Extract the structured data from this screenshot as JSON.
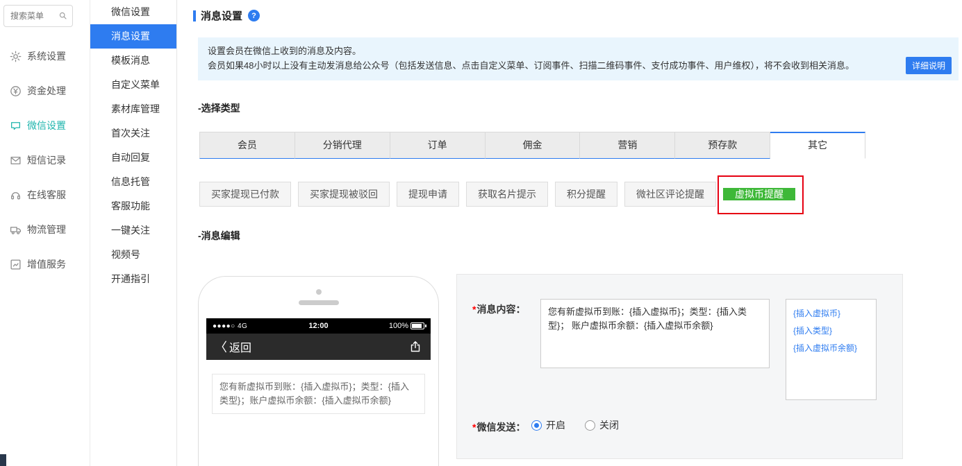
{
  "sidebar": {
    "search": {
      "placeholder": "搜索菜单"
    },
    "items": [
      {
        "label": "系统设置"
      },
      {
        "label": "资金处理"
      },
      {
        "label": "微信设置"
      },
      {
        "label": "短信记录"
      },
      {
        "label": "在线客服"
      },
      {
        "label": "物流管理"
      },
      {
        "label": "增值服务"
      }
    ]
  },
  "submenu": {
    "items": [
      {
        "label": "微信设置"
      },
      {
        "label": "消息设置"
      },
      {
        "label": "模板消息"
      },
      {
        "label": "自定义菜单"
      },
      {
        "label": "素材库管理"
      },
      {
        "label": "首次关注"
      },
      {
        "label": "自动回复"
      },
      {
        "label": "信息托管"
      },
      {
        "label": "客服功能"
      },
      {
        "label": "一键关注"
      },
      {
        "label": "视频号"
      },
      {
        "label": "开通指引"
      }
    ]
  },
  "main": {
    "title": "消息设置",
    "help_icon": "?",
    "notice": {
      "line1": "设置会员在微信上收到的消息及内容。",
      "line2": "会员如果48小时以上没有主动发消息给公众号（包括发送信息、点击自定义菜单、订阅事件、扫描二维码事件、支付成功事件、用户维权），将不会收到相关消息。",
      "detail_button": "详细说明"
    },
    "select_type_heading": "-选择类型",
    "message_edit_heading": "-消息编辑",
    "tabs": [
      {
        "label": "会员"
      },
      {
        "label": "分销代理"
      },
      {
        "label": "订单"
      },
      {
        "label": "佣金"
      },
      {
        "label": "营销"
      },
      {
        "label": "预存款"
      },
      {
        "label": "其它"
      }
    ],
    "type_buttons": [
      {
        "label": "买家提现已付款"
      },
      {
        "label": "买家提现被驳回"
      },
      {
        "label": "提现申请"
      },
      {
        "label": "获取名片提示"
      },
      {
        "label": "积分提醒"
      },
      {
        "label": "微社区评论提醒"
      },
      {
        "label": "虚拟币提醒"
      }
    ]
  },
  "phone": {
    "signal": "●●●●○ 4G",
    "time": "12:00",
    "battery": "100%",
    "back_chevron": "〈",
    "back_label": "返回",
    "message": "您有新虚拟币到账：{插入虚拟币}；类型：{插入类型}；账户虚拟币余额：{插入虚拟币余额}"
  },
  "form": {
    "required_mark": "*",
    "message_label": "消息内容：",
    "message_value": "您有新虚拟币到账：{插入虚拟币}；类型：{插入类型}； 账户虚拟币余额：{插入虚拟币余额}",
    "insert_links": [
      {
        "label": "{插入虚拟币}"
      },
      {
        "label": "{插入类型}"
      },
      {
        "label": "{插入虚拟币余额}"
      }
    ],
    "send_label": "微信发送：",
    "options": [
      {
        "label": "开启"
      },
      {
        "label": "关闭"
      }
    ]
  },
  "colors": {
    "accent_blue": "#2e7cf0",
    "active_green": "#3eb838",
    "annotation_red": "#e60012",
    "sidebar_active_teal": "#1fb5ad"
  }
}
